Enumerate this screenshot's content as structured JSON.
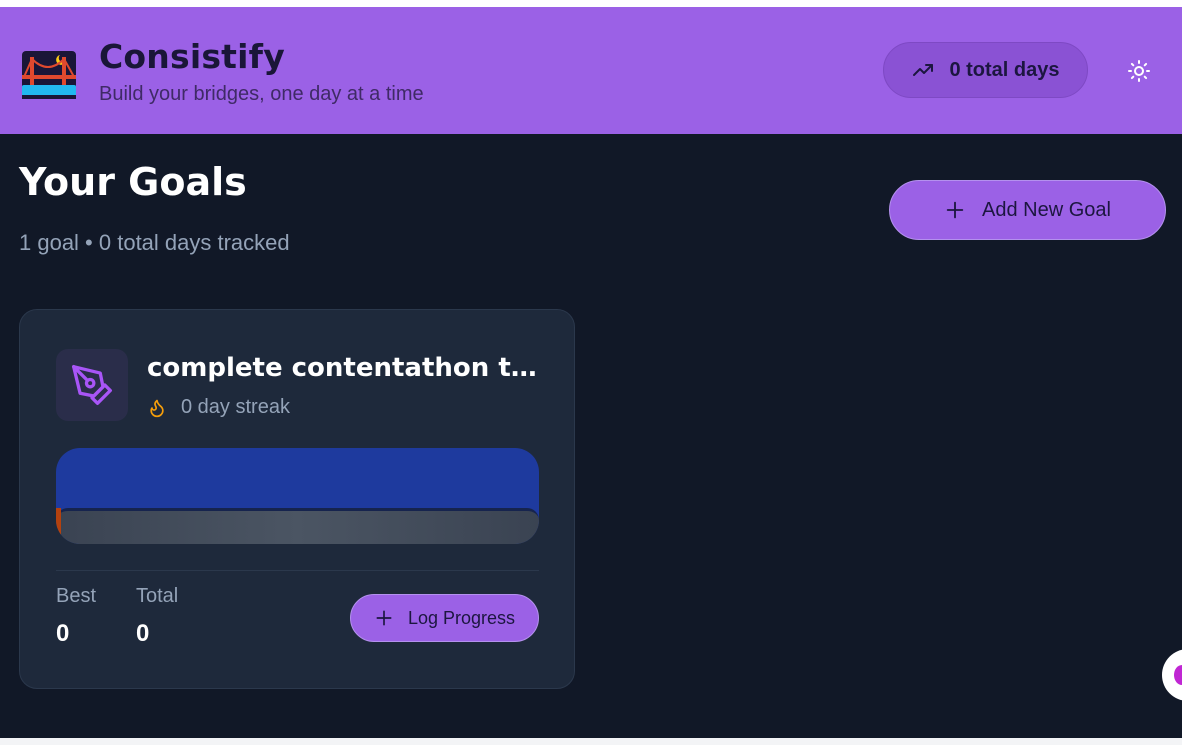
{
  "header": {
    "title": "Consistify",
    "subtitle": "Build your bridges, one day at a time",
    "total_days": "0 total days"
  },
  "main": {
    "title": "Your Goals",
    "summary": "1 goal • 0 total days tracked",
    "add_goal_label": "Add New Goal"
  },
  "goals": [
    {
      "name": "complete contentathon thr...",
      "streak": "0 day streak",
      "progress": 0,
      "best_label": "Best",
      "best_value": "0",
      "total_label": "Total",
      "total_value": "0",
      "log_label": "Log Progress"
    }
  ],
  "colors": {
    "header_bg": "#9b61e6",
    "app_bg": "#111827",
    "card_bg": "#1e293b",
    "accent": "#9b61e6",
    "streak_flame": "#f59e0b"
  },
  "icons": {
    "logo": "bridge-logo-icon",
    "total_days": "trending-up-icon",
    "theme": "sun-icon",
    "add": "plus-icon",
    "goal": "pen-tool-icon",
    "streak": "flame-icon"
  }
}
